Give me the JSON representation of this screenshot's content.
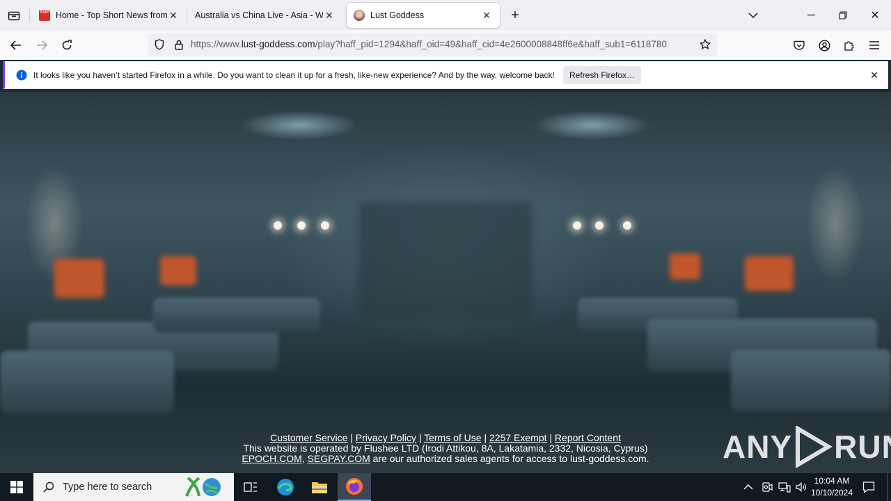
{
  "browser": {
    "tabs": [
      {
        "title": "Home - Top Short News from A",
        "favicon_label": "TOP"
      },
      {
        "title": "Australia vs China Live - Asia - Worl"
      },
      {
        "title": "Lust Goddess"
      }
    ],
    "url_prefix": "https://www.",
    "url_host": "lust-goddess.com",
    "url_path": "/play?haff_pid=1294&haff_oid=49&haff_cid=4e2600008848ff6e&haff_sub1=6118780",
    "notification": {
      "text": "It looks like you haven’t started Firefox in a while. Do you want to clean it up for a fresh, like-new experience? And by the way, welcome back!",
      "button": "Refresh Firefox…"
    }
  },
  "page": {
    "links": [
      "Customer Service",
      "Privacy Policy",
      "Terms of Use",
      "2257 Exempt",
      "Report Content"
    ],
    "separator": " | ",
    "operator_line": "This website is operated by Flushee LTD (Irodi Attikou, 8A, Lakatamia, 2332, Nicosia, Cyprus)",
    "agent_1": "EPOCH.COM",
    "agent_sep": ", ",
    "agent_2": "SEGPAY.COM",
    "agents_tail": " are our authorized sales agents for access to lust-goddess.com."
  },
  "watermark": {
    "left": "ANY",
    "right": "RUN"
  },
  "taskbar": {
    "search_placeholder": "Type here to search",
    "time": "10:04 AM",
    "date": "10/10/2024"
  },
  "colors": {
    "accent": "#7c3aed",
    "firefox_orange": "#ff7139",
    "taskbar": "#101820"
  }
}
